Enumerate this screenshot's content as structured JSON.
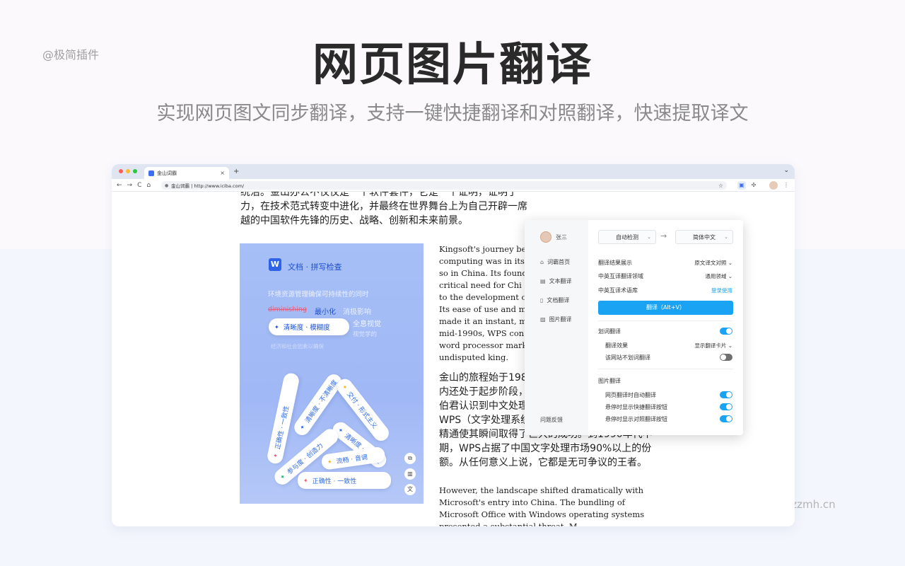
{
  "watermark_top": "@极简插件",
  "watermark_bottom": "chrome.zzzmh.cn",
  "hero": {
    "title": "网页图片翻译",
    "subtitle": "实现网页图文同步翻译，支持一键快捷翻译和对照翻译，快速提取译文"
  },
  "browser": {
    "tab_title": "金山词霸",
    "tab_close": "×",
    "new_tab": "+",
    "url": "金山词霸 | http://www.iciba.com/",
    "nav": {
      "back": "←",
      "forward": "→",
      "reload": "C",
      "home": "⌂"
    }
  },
  "article": {
    "cn_top_lines": [
      "统治。金山办公不仅仅是一个软件套件，它是一个证明，证明了",
      "力，在技术范式转变中进化，并最终在世界舞台上为自己开辟一席",
      "越的中国软件先锋的历史、战略、创新和未来前景。"
    ],
    "en_block_1": [
      "Kingsoft's journey be",
      "computing was in its",
      "so in China. Its found",
      "critical need for Chi",
      "to the development o",
      "Its ease of use and ma",
      "made it an instant, m",
      "mid-1990s, WPS con",
      "word processor mark",
      "undisputed king."
    ],
    "cn_block_2": [
      "金山的旅程始于198",
      "内还处于起步阶段，",
      "伯君认识到中文处理的迫切需求，从而开发了",
      "WPS（文字处理系统）。其易用性和对中文排版的",
      "精通使其瞬间取得了巨大的成功。到1990年代中",
      "期，WPS占据了中国文字处理市场90%以上的份",
      "额。从任何意义上说，它都是无可争议的王者。"
    ],
    "en_block_3": [
      "However, the landscape shifted dramatically with",
      "Microsoft's entry into China. The bundling of",
      "Microsoft Office with Windows operating systems",
      "presented a substantial threat. M"
    ]
  },
  "image_card": {
    "logo_letter": "W",
    "header": "文档 · 拼写检查",
    "line1": "环境资源管理确保可持续性的同时",
    "strike_word": "diminishing",
    "minimize": "最小化",
    "negative": "消极影响",
    "query_pill": "清晰度 · 模糊度",
    "ghost1": "全息视觉",
    "ghost2": "视觉学的",
    "ghost3": "经济和社会因素以确保",
    "pills": [
      "正确性 · 一致性",
      "清晰度 · 不清晰度",
      "交付 · 形式主义",
      "清晰度 · 流畅度",
      "参与度 · 创造力",
      "流畅 · 音调",
      "正确性 · 一致性"
    ]
  },
  "panel": {
    "user_name": "张三",
    "nav": [
      "词霸首页",
      "文本翻译",
      "文档翻译",
      "图片翻译"
    ],
    "feedback": "问题反馈",
    "source_lang": "自动检测",
    "target_lang": "简体中文",
    "arrow": "→",
    "result_display_label": "翻译结果展示",
    "result_display_value": "原文译文对照",
    "domain_label": "中英互译翻译领域",
    "domain_value": "通用领域",
    "glossary_label": "中英互译术语库",
    "glossary_link": "登录使用",
    "translate_button": "翻译（Alt+V）",
    "word_translate_label": "划词翻译",
    "effect_label": "翻译效果",
    "effect_value": "显示翻译卡片",
    "site_no_translate_label": "该网站不划词翻译",
    "image_section": "图片翻译",
    "auto_translate_label": "网页翻译时自动翻译",
    "hover_quick_label": "悬停时显示快捷翻译按钮",
    "hover_compare_label": "悬停时显示对照翻译按钮",
    "toggles": {
      "word_translate": true,
      "site_no_translate": false,
      "auto_translate": true,
      "hover_quick": true,
      "hover_compare": true
    }
  },
  "colors": {
    "accent": "#1aa3f2",
    "card_blue": "#a6bff6",
    "brand_blue": "#2f63e7"
  }
}
